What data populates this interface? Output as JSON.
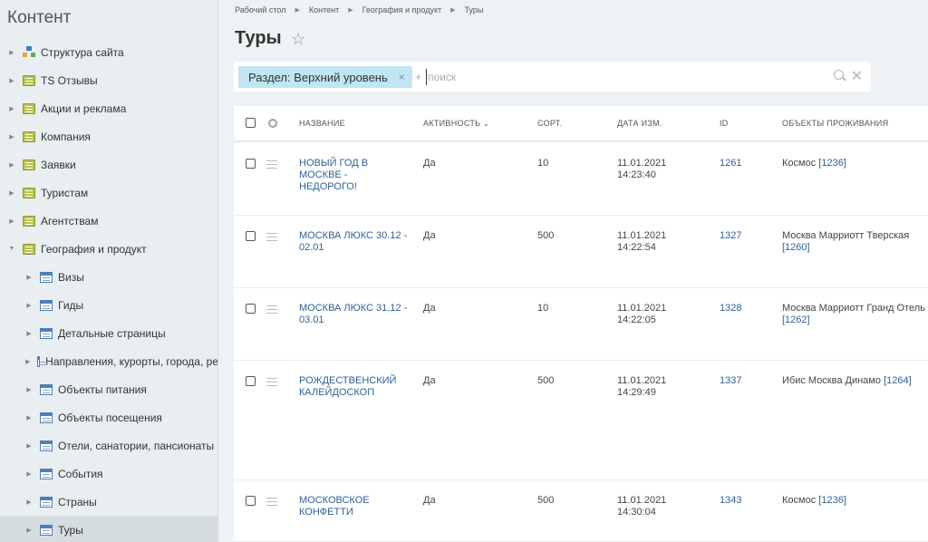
{
  "sidebar": {
    "title": "Контент",
    "items": [
      {
        "label": "Структура сайта",
        "icon": "structure-icon",
        "level": 0
      },
      {
        "label": "TS Отзывы",
        "icon": "folder-icon",
        "level": 0
      },
      {
        "label": "Акции и реклама",
        "icon": "folder-icon",
        "level": 0
      },
      {
        "label": "Компания",
        "icon": "folder-icon",
        "level": 0
      },
      {
        "label": "Заявки",
        "icon": "folder-icon",
        "level": 0
      },
      {
        "label": "Туристам",
        "icon": "folder-icon",
        "level": 0
      },
      {
        "label": "Агентствам",
        "icon": "folder-icon",
        "level": 0
      },
      {
        "label": "География и продукт",
        "icon": "folder-icon",
        "level": 0,
        "expanded": true
      },
      {
        "label": "Визы",
        "icon": "list-icon",
        "level": 1
      },
      {
        "label": "Гиды",
        "icon": "list-icon",
        "level": 1
      },
      {
        "label": "Детальные страницы",
        "icon": "list-icon",
        "level": 1
      },
      {
        "label": "Направления, курорты, города, ре",
        "icon": "list-icon",
        "level": 1
      },
      {
        "label": "Объекты питания",
        "icon": "list-icon",
        "level": 1
      },
      {
        "label": "Объекты посещения",
        "icon": "list-icon",
        "level": 1
      },
      {
        "label": "Отели, санатории, пансионаты",
        "icon": "list-icon",
        "level": 1
      },
      {
        "label": "События",
        "icon": "list-icon",
        "level": 1
      },
      {
        "label": "Страны",
        "icon": "list-icon",
        "level": 1
      },
      {
        "label": "Туры",
        "icon": "list-icon",
        "level": 1,
        "active": true
      }
    ]
  },
  "breadcrumb": [
    "Рабочий стол",
    "Контент",
    "География и продукт",
    "Туры"
  ],
  "page": {
    "title": "Туры"
  },
  "filter": {
    "chip_label": "Раздел: Верхний уровень",
    "chip_remove": "×",
    "plus": "+",
    "placeholder": "поиск",
    "clear": "✕"
  },
  "table": {
    "columns": {
      "name": "НАЗВАНИЕ",
      "active": "АКТИВНОСТЬ",
      "sort": "СОРТ.",
      "date": "ДАТА ИЗМ.",
      "id": "ID",
      "objects": "ОБЪЕКТЫ ПРОЖИВАНИЯ"
    },
    "rows": [
      {
        "name": "НОВЫЙ ГОД В МОСКВЕ - НЕДОРОГО!",
        "active": "Да",
        "sort": "10",
        "date": "11.01.2021",
        "time": "14:23:40",
        "id": "1261",
        "object_name": "Космос",
        "object_id": "[1236]"
      },
      {
        "name": "МОСКВА ЛЮКС 30.12 - 02.01",
        "active": "Да",
        "sort": "500",
        "date": "11.01.2021",
        "time": "14:22:54",
        "id": "1327",
        "object_name": "Москва Марриотт Тверская",
        "object_id": "[1260]"
      },
      {
        "name": "МОСКВА ЛЮКС 31.12 - 03.01",
        "active": "Да",
        "sort": "10",
        "date": "11.01.2021",
        "time": "14:22:05",
        "id": "1328",
        "object_name": "Москва Марриотт Гранд Отель",
        "object_id": "[1262]"
      },
      {
        "name": "РОЖДЕСТВЕНСКИЙ КАЛЕЙДОСКОП",
        "active": "Да",
        "sort": "500",
        "date": "11.01.2021",
        "time": "14:29:49",
        "id": "1337",
        "object_name": "Ибис Москва Динамо",
        "object_id": "[1264]"
      },
      {
        "name": "МОСКОВСКОЕ КОНФЕТТИ",
        "active": "Да",
        "sort": "500",
        "date": "11.01.2021",
        "time": "14:30:04",
        "id": "1343",
        "object_name": "Космос",
        "object_id": "[1236]"
      }
    ]
  }
}
